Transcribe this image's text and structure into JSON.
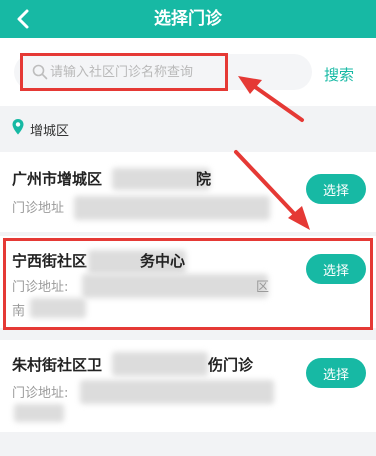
{
  "header": {
    "title": "选择门诊"
  },
  "search": {
    "placeholder": "请输入社区门诊名称查询",
    "button": "搜索"
  },
  "district": {
    "name": "增城区"
  },
  "clinics": [
    {
      "name_start": "广州市增城区",
      "name_end": "院",
      "addr_label": "门诊地址",
      "select_label": "选择"
    },
    {
      "name_start": "宁西街社区",
      "name_end": "务中心",
      "addr_label": "门诊地址:",
      "addr_line2": "南",
      "addr_end": "区",
      "select_label": "选择"
    },
    {
      "name_start": "朱村街社区卫",
      "name_end": "伤门诊",
      "addr_label": "门诊地址:",
      "select_label": "选择"
    }
  ],
  "colors": {
    "accent": "#17b9a4",
    "annotation": "#e53935"
  },
  "icons": {
    "back": "chevron-left-icon",
    "search": "search-icon",
    "location": "location-pin-icon"
  }
}
